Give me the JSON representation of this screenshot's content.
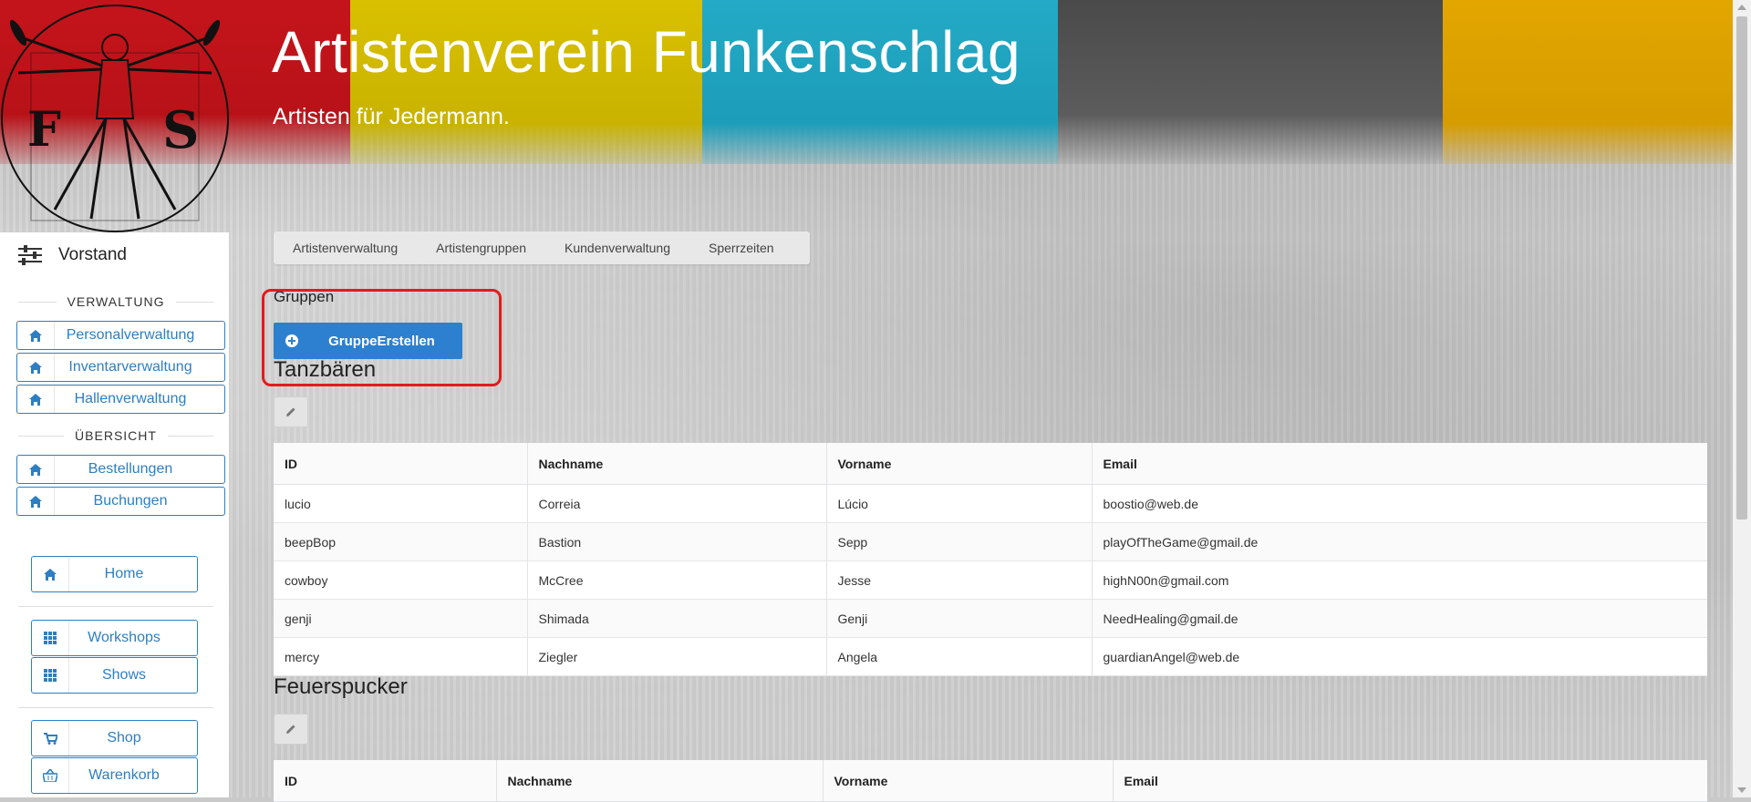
{
  "header": {
    "title": "Artistenverein Funkenschlag",
    "subtitle": "Artisten für Jedermann.",
    "logo": "vitruvian-man-logo",
    "logo_letters": "F S",
    "stripe_colors": [
      "#c4141b",
      "#d9c000",
      "#24aac6",
      "#4a4a4a",
      "#e3a600"
    ]
  },
  "sidebar": {
    "title": "Vorstand",
    "title_icon": "sliders-icon",
    "sections": [
      {
        "label": "VERWALTUNG",
        "items": [
          {
            "label": "Personalverwaltung",
            "icon": "home-icon"
          },
          {
            "label": "Inventarverwaltung",
            "icon": "home-icon"
          },
          {
            "label": "Hallenverwaltung",
            "icon": "home-icon"
          }
        ]
      },
      {
        "label": "ÜBERSICHT",
        "items": [
          {
            "label": "Bestellungen",
            "icon": "home-icon"
          },
          {
            "label": "Buchungen",
            "icon": "home-icon"
          }
        ]
      }
    ],
    "nav": [
      {
        "label": "Home",
        "icon": "home-icon"
      },
      {
        "label": "Workshops",
        "icon": "grid-icon"
      },
      {
        "label": "Shows",
        "icon": "grid-icon"
      },
      {
        "label": "Shop",
        "icon": "cart-icon"
      },
      {
        "label": "Warenkorb",
        "icon": "basket-icon"
      }
    ]
  },
  "tabs": [
    "Artistenverwaltung",
    "Artistengruppen",
    "Kundenverwaltung",
    "Sperrzeiten"
  ],
  "main": {
    "section_label": "Gruppen",
    "create_button": "GruppeErstellen",
    "accent_color": "#2d7fd0",
    "highlight_color": "#e31b1b",
    "groups": [
      {
        "name": "Tanzbären",
        "columns": [
          "ID",
          "Nachname",
          "Vorname",
          "Email"
        ],
        "rows": [
          [
            "lucio",
            "Correia",
            "Lúcio",
            "boostio@web.de"
          ],
          [
            "beepBop",
            "Bastion",
            "Sepp",
            "playOfTheGame@gmail.de"
          ],
          [
            "cowboy",
            "McCree",
            "Jesse",
            "highN00n@gmail.com"
          ],
          [
            "genji",
            "Shimada",
            "Genji",
            "NeedHealing@gmail.de"
          ],
          [
            "mercy",
            "Ziegler",
            "Angela",
            "guardianAngel@web.de"
          ]
        ]
      },
      {
        "name": "Feuerspucker",
        "columns": [
          "ID",
          "Nachname",
          "Vorname",
          "Email"
        ],
        "rows": []
      }
    ]
  }
}
